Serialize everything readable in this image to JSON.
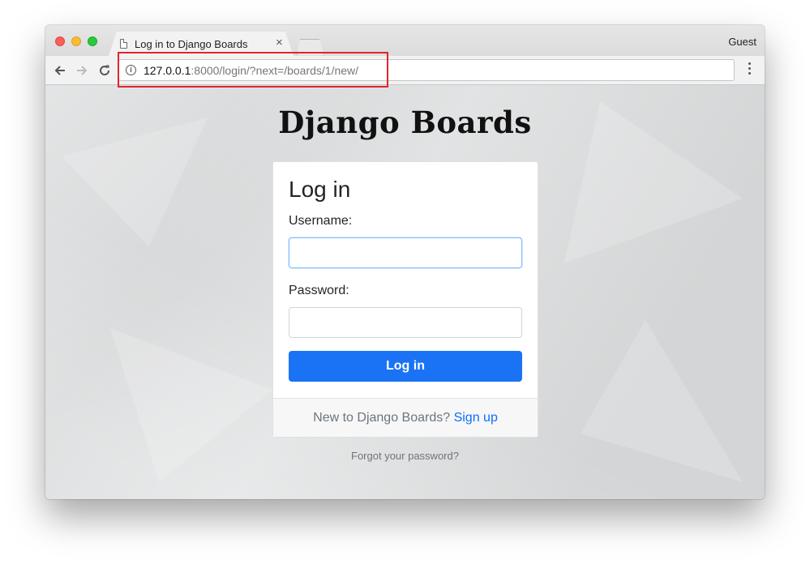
{
  "browser": {
    "tab_title": "Log in to Django Boards",
    "tab_close": "×",
    "profile": "Guest",
    "url_host": "127.0.0.1",
    "url_rest": ":8000/login/?next=/boards/1/new/"
  },
  "page": {
    "brand": "Django Boards",
    "card_title": "Log in",
    "username_label": "Username:",
    "username_value": "",
    "password_label": "Password:",
    "password_value": "",
    "login_button": "Log in",
    "footer_text": "New to Django Boards?",
    "signup_link": "Sign up",
    "forgot_link": "Forgot your password?"
  },
  "colors": {
    "primary": "#1a73f5",
    "highlight": "#e0262b"
  }
}
